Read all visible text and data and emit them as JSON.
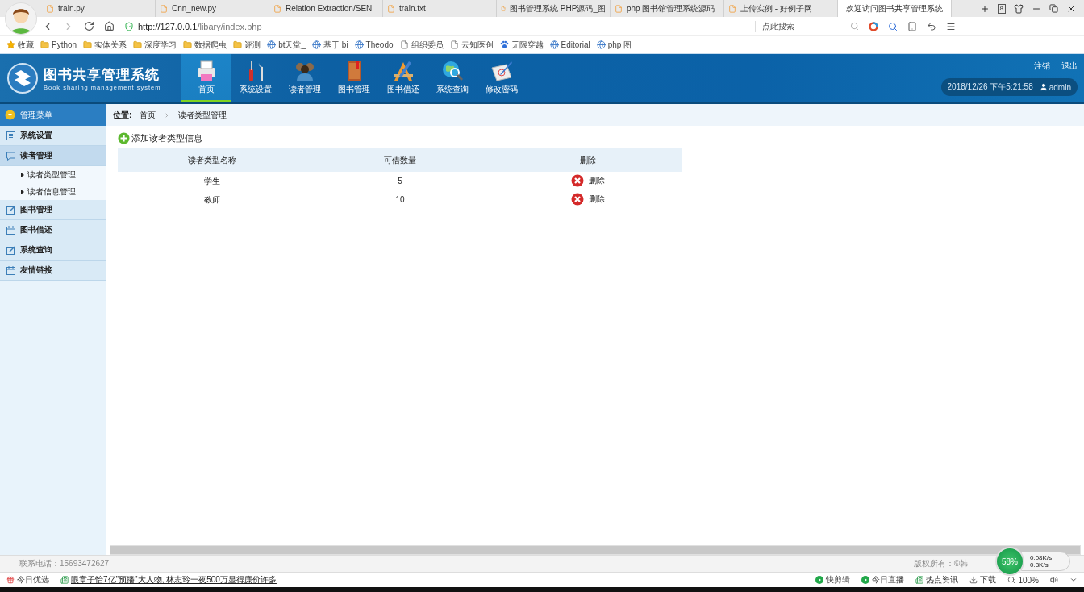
{
  "browser": {
    "tabs": [
      {
        "title": "train.py",
        "selected": false
      },
      {
        "title": "Cnn_new.py",
        "selected": false
      },
      {
        "title": "Relation Extraction/SEN",
        "selected": false
      },
      {
        "title": "train.txt",
        "selected": false
      },
      {
        "title": "图书管理系统 PHP源码_图",
        "selected": false
      },
      {
        "title": "php 图书馆管理系统源码",
        "selected": false
      },
      {
        "title": "上传实例 - 好例子网",
        "selected": false
      },
      {
        "title": "欢迎访问图书共享管理系统",
        "selected": true
      }
    ],
    "tab_count": "8",
    "address": {
      "host": "http://127.0.0.1",
      "path": "/libary/index.php"
    },
    "search": {
      "placeholder": "点此搜索"
    },
    "bookmarks": [
      {
        "label": "收藏",
        "kind": "star"
      },
      {
        "label": "Python",
        "kind": "folder"
      },
      {
        "label": "实体关系",
        "kind": "folder"
      },
      {
        "label": "深度学习",
        "kind": "folder"
      },
      {
        "label": "数据爬虫",
        "kind": "folder"
      },
      {
        "label": "评测",
        "kind": "folder"
      },
      {
        "label": "bt天堂_",
        "kind": "site"
      },
      {
        "label": "基于 bi",
        "kind": "site"
      },
      {
        "label": "Theodo",
        "kind": "site"
      },
      {
        "label": "组织委员",
        "kind": "page"
      },
      {
        "label": "云知医创",
        "kind": "page"
      },
      {
        "label": "无限穿越",
        "kind": "paw"
      },
      {
        "label": "Editorial",
        "kind": "site"
      },
      {
        "label": "php 图",
        "kind": "site"
      }
    ],
    "status_bar": {
      "left": [
        {
          "label": "今日优选",
          "kind": "gift"
        },
        {
          "label": "眼章子怡7亿\"预播\"大人物, 林志玲一夜500万显得廉价许多",
          "kind": "news"
        }
      ],
      "right": [
        {
          "label": "快剪辑",
          "kind": "play"
        },
        {
          "label": "今日直播",
          "kind": "play"
        },
        {
          "label": "热点资讯",
          "kind": "news"
        },
        {
          "label": "下载",
          "kind": "download"
        },
        {
          "label": "100%",
          "kind": "zoom"
        }
      ]
    },
    "net_widget": {
      "percent": "58%",
      "up": "0.08K/s",
      "down": "0.3K/s"
    }
  },
  "app": {
    "logo": {
      "title": "图书共享管理系统",
      "subtitle": "Book sharing management system"
    },
    "nav": [
      {
        "label": "首页",
        "kind": "printer",
        "selected": true
      },
      {
        "label": "系统设置",
        "kind": "tools",
        "selected": false
      },
      {
        "label": "读者管理",
        "kind": "people",
        "selected": false
      },
      {
        "label": "图书管理",
        "kind": "book",
        "selected": false
      },
      {
        "label": "图书借还",
        "kind": "pencil",
        "selected": false
      },
      {
        "label": "系统查询",
        "kind": "globe",
        "selected": false
      },
      {
        "label": "修改密码",
        "kind": "paper",
        "selected": false
      }
    ],
    "links": [
      "注销",
      "退出"
    ],
    "datetime": "2018/12/26 下午5:21:58",
    "user": "admin",
    "sidebar": {
      "title": "管理菜单",
      "items": [
        {
          "label": "系统设置",
          "kind": "list",
          "expanded": false
        },
        {
          "label": "读者管理",
          "kind": "chat",
          "expanded": true,
          "children": [
            {
              "label": "读者类型管理"
            },
            {
              "label": "读者信息管理"
            }
          ]
        },
        {
          "label": "图书管理",
          "kind": "edit",
          "expanded": false
        },
        {
          "label": "图书借还",
          "kind": "calendar",
          "expanded": false
        },
        {
          "label": "系统查询",
          "kind": "edit",
          "expanded": false
        },
        {
          "label": "友情链接",
          "kind": "calendar",
          "expanded": false
        }
      ]
    },
    "breadcrumb": {
      "label": "位置:",
      "path": [
        "首页",
        "读者类型管理"
      ]
    },
    "add_button": "添加读者类型信息",
    "table": {
      "columns": [
        "读者类型名称",
        "可借数量",
        "删除"
      ],
      "rows": [
        {
          "name": "学生",
          "count": "5",
          "action": "删除"
        },
        {
          "name": "教师",
          "count": "10",
          "action": "删除"
        }
      ]
    },
    "footer": {
      "phone": "联系电话：15693472627",
      "copyright": "版权所有：©韩"
    }
  }
}
